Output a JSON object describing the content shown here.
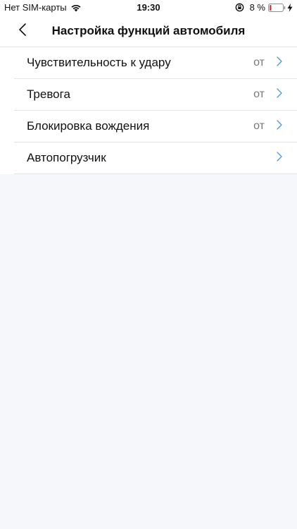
{
  "status_bar": {
    "carrier": "Нет SIM-карты",
    "time": "19:30",
    "battery_percent": "8 %",
    "icons": [
      "wifi-icon",
      "lock-rotation-icon",
      "battery-icon",
      "charging-icon"
    ]
  },
  "header": {
    "title": "Настройка функций автомобиля",
    "back_icon": "chevron-left-icon"
  },
  "settings": {
    "items": [
      {
        "label": "Чувствительность к удару",
        "value": "от"
      },
      {
        "label": "Тревога",
        "value": "от"
      },
      {
        "label": "Блокировка вождения",
        "value": "от"
      },
      {
        "label": "Автопогрузчик",
        "value": ""
      }
    ]
  },
  "colors": {
    "accent": "#4a9bd8",
    "background": "#f6f7fb",
    "battery_low": "#e0383e"
  }
}
